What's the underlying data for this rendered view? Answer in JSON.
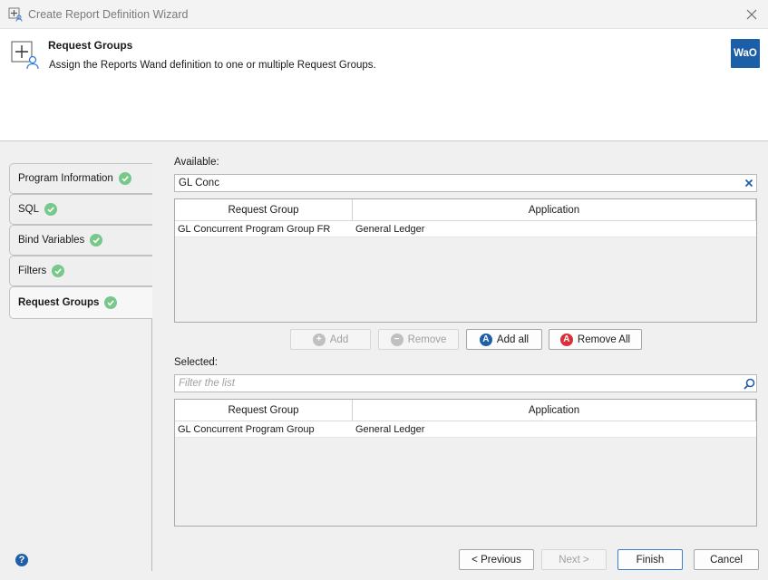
{
  "window": {
    "title": "Create Report Definition Wizard",
    "app_icon": "wizard-icon",
    "close_icon": "close-icon"
  },
  "header": {
    "title": "Request Groups",
    "subtitle": "Assign the Reports Wand definition to one or multiple Request Groups.",
    "logo_text": "WaO",
    "logo_color": "#1d5fa6"
  },
  "nav": {
    "items": [
      {
        "label": "Program Information",
        "status": "complete"
      },
      {
        "label": "SQL",
        "status": "complete"
      },
      {
        "label": "Bind Variables",
        "status": "complete"
      },
      {
        "label": "Filters",
        "status": "complete"
      },
      {
        "label": "Request Groups",
        "status": "complete",
        "active": true
      }
    ],
    "check_color": "#77c88a"
  },
  "available": {
    "label": "Available:",
    "search_value": "GL Conc",
    "clear_icon": "clear-x-icon",
    "columns": [
      "Request Group",
      "Application"
    ],
    "rows": [
      {
        "request_group": "GL Concurrent Program Group FR",
        "application": "General Ledger"
      }
    ]
  },
  "actions": {
    "add": {
      "label": "Add",
      "enabled": false
    },
    "remove": {
      "label": "Remove",
      "enabled": false
    },
    "add_all": {
      "label": "Add all",
      "enabled": true,
      "icon_color": "#1f5fa8"
    },
    "remove_all": {
      "label": "Remove All",
      "enabled": true,
      "icon_color": "#d9303a"
    }
  },
  "selected": {
    "label": "Selected:",
    "filter_placeholder": "Filter the list",
    "search_icon": "search-icon",
    "columns": [
      "Request Group",
      "Application"
    ],
    "rows": [
      {
        "request_group": "GL Concurrent Program Group",
        "application": "General Ledger"
      }
    ]
  },
  "footer": {
    "previous": "< Previous",
    "next": "Next >",
    "finish": "Finish",
    "cancel": "Cancel",
    "help_icon": "help-icon"
  }
}
